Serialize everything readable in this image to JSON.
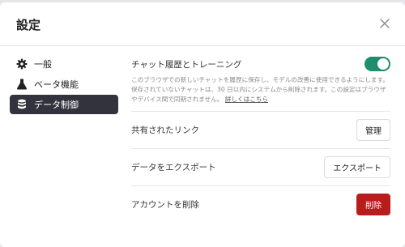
{
  "dialog": {
    "title": "設定",
    "close_icon": "close-icon"
  },
  "sidebar": {
    "items": [
      {
        "label": "一般",
        "icon": "gear-icon",
        "active": false
      },
      {
        "label": "ベータ機能",
        "icon": "flask-icon",
        "active": false
      },
      {
        "label": "データ制御",
        "icon": "database-icon",
        "active": true
      }
    ]
  },
  "settings": {
    "chat_history": {
      "label": "チャット履歴とトレーニング",
      "description": "このブラウザでの新しいチャットを履歴に保存し、モデルの改善に使用できるようにします。保存されていないチャットは、30 日以内にシステムから削除されます。この設定はブラウザやデバイス間で同期されません。",
      "link": "詳しくはこちら",
      "toggle_on": true
    },
    "shared_links": {
      "label": "共有されたリンク",
      "button": "管理"
    },
    "export": {
      "label": "データをエクスポート",
      "button": "エクスポート"
    },
    "delete_account": {
      "label": "アカウントを削除",
      "button": "削除"
    }
  },
  "colors": {
    "toggle_on": "#1e8e6e",
    "danger": "#b91c1c",
    "active_nav": "#33333d"
  }
}
